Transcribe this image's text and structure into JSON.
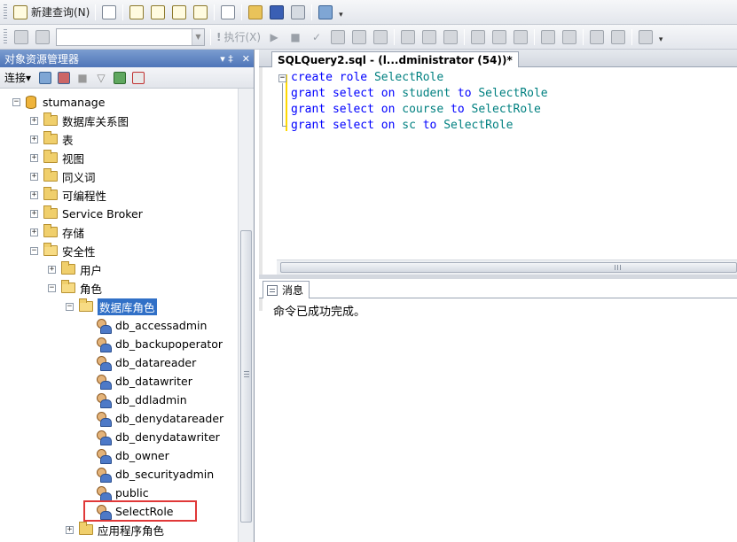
{
  "toolbar1": {
    "new_query_label": "新建查询(N)"
  },
  "toolbar2": {
    "execute_label": "执行(X)",
    "database_selected": ""
  },
  "object_explorer": {
    "title": "对象资源管理器",
    "pin": "▾ ‡",
    "close": "✕",
    "connect_label": "连接",
    "tree": {
      "database": "stumanage",
      "items": [
        "数据库关系图",
        "表",
        "视图",
        "同义词",
        "可编程性",
        "Service Broker",
        "存储",
        "安全性",
        "用户",
        "角色",
        "数据库角色",
        "db_accessadmin",
        "db_backupoperator",
        "db_datareader",
        "db_datawriter",
        "db_ddladmin",
        "db_denydatareader",
        "db_denydatawriter",
        "db_owner",
        "db_securityadmin",
        "public",
        "SelectRole",
        "应用程序角色"
      ]
    }
  },
  "editor": {
    "tab_title": "SQLQuery2.sql - (l...dministrator (54))*",
    "lines": [
      {
        "kw1": "create",
        "kw2": "role",
        "name": "SelectRole"
      },
      {
        "kw1": "grant",
        "kw2": "select",
        "kw3": "on",
        "table": "student",
        "kw4": "to",
        "name": "SelectRole"
      },
      {
        "kw1": "grant",
        "kw2": "select",
        "kw3": "on",
        "table": "course",
        "kw4": "to",
        "name": "SelectRole"
      },
      {
        "kw1": "grant",
        "kw2": "select",
        "kw3": "on",
        "table": "sc",
        "kw4": "to",
        "name": "SelectRole"
      }
    ]
  },
  "results": {
    "tab_label": "消息",
    "message": "命令已成功完成。"
  },
  "colors": {
    "keyword": "#0000ff",
    "identifier": "#008080",
    "panel_title": "#4f75b8",
    "selection": "#3170c7",
    "highlight_box": "#e03838"
  }
}
